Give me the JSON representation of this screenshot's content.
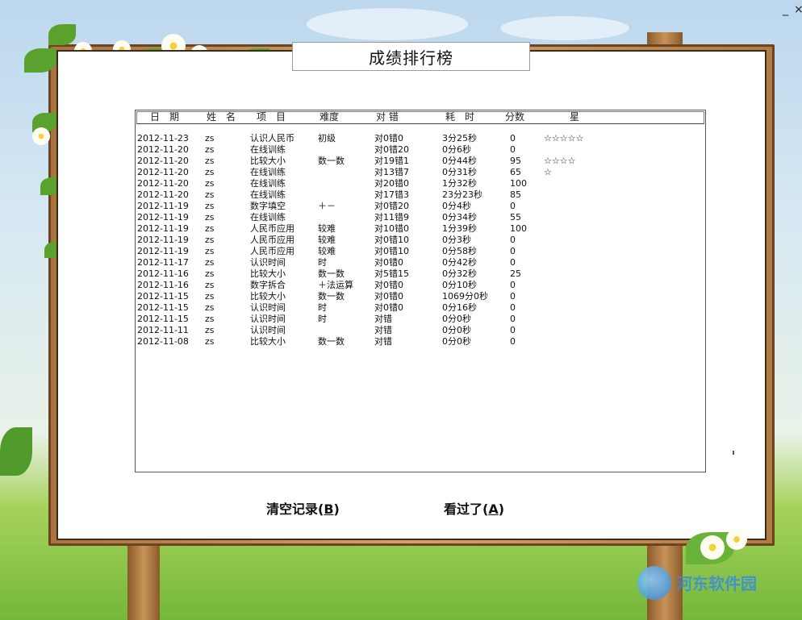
{
  "window": {
    "minimize_label": "_",
    "close_label": "×"
  },
  "title": "成绩排行榜",
  "table": {
    "headers": [
      "日　期",
      "姓　名",
      "项　目",
      "难度",
      "对 错",
      "耗　时",
      "分数",
      "星"
    ],
    "rows": [
      [
        "2012-11-23",
        "zs",
        "认识人民币",
        "初级",
        "对0错0",
        "3分25秒",
        "0",
        "☆☆☆☆☆"
      ],
      [
        "2012-11-20",
        "zs",
        "在线训练",
        "",
        "对0错20",
        "0分6秒",
        "0",
        ""
      ],
      [
        "2012-11-20",
        "zs",
        "比较大小",
        "数一数",
        "对19错1",
        "0分44秒",
        "95",
        "☆☆☆☆"
      ],
      [
        "2012-11-20",
        "zs",
        "在线训练",
        "",
        "对13错7",
        "0分31秒",
        "65",
        "☆"
      ],
      [
        "2012-11-20",
        "zs",
        "在线训练",
        "",
        "对20错0",
        "1分32秒",
        "100",
        ""
      ],
      [
        "2012-11-20",
        "zs",
        "在线训练",
        "",
        "对17错3",
        "23分23秒",
        "85",
        ""
      ],
      [
        "2012-11-19",
        "zs",
        "数字填空",
        "＋－",
        "对0错20",
        "0分4秒",
        "0",
        ""
      ],
      [
        "2012-11-19",
        "zs",
        "在线训练",
        "",
        "对11错9",
        "0分34秒",
        "55",
        ""
      ],
      [
        "2012-11-19",
        "zs",
        "人民币应用",
        "较难",
        "对10错0",
        "1分39秒",
        "100",
        ""
      ],
      [
        "2012-11-19",
        "zs",
        "人民币应用",
        "较难",
        "对0错10",
        "0分3秒",
        "0",
        ""
      ],
      [
        "2012-11-19",
        "zs",
        "人民币应用",
        "较难",
        "对0错10",
        "0分58秒",
        "0",
        ""
      ],
      [
        "2012-11-17",
        "zs",
        "认识时间",
        "时",
        "对0错0",
        "0分42秒",
        "0",
        ""
      ],
      [
        "2012-11-16",
        "zs",
        "比较大小",
        "数一数",
        "对5错15",
        "0分32秒",
        "25",
        ""
      ],
      [
        "2012-11-16",
        "zs",
        "数字拆合",
        "＋法运算",
        "对0错0",
        "0分10秒",
        "0",
        ""
      ],
      [
        "2012-11-15",
        "zs",
        "比较大小",
        "数一数",
        "对0错0",
        "1069分0秒",
        "0",
        ""
      ],
      [
        "2012-11-15",
        "zs",
        "认识时间",
        "时",
        "对0错0",
        "0分16秒",
        "0",
        ""
      ],
      [
        "2012-11-15",
        "zs",
        "认识时间",
        "时",
        "对错",
        "0分0秒",
        "0",
        ""
      ],
      [
        "2012-11-11",
        "zs",
        "认识时间",
        "",
        "对错",
        "0分0秒",
        "0",
        ""
      ],
      [
        "2012-11-08",
        "zs",
        "比较大小",
        "数一数",
        "对错",
        "0分0秒",
        "0",
        ""
      ]
    ]
  },
  "buttons": {
    "clear": {
      "text": "清空记录(",
      "key": "B",
      "suffix": ")"
    },
    "ok": {
      "text": "看过了(",
      "key": "A",
      "suffix": ")"
    }
  },
  "watermark": {
    "name": "河东软件园"
  },
  "colors": {
    "board": "#ffffff",
    "frame_wood": "#b07b45",
    "sky": "#bcd7ee",
    "grass": "#74b83b"
  }
}
